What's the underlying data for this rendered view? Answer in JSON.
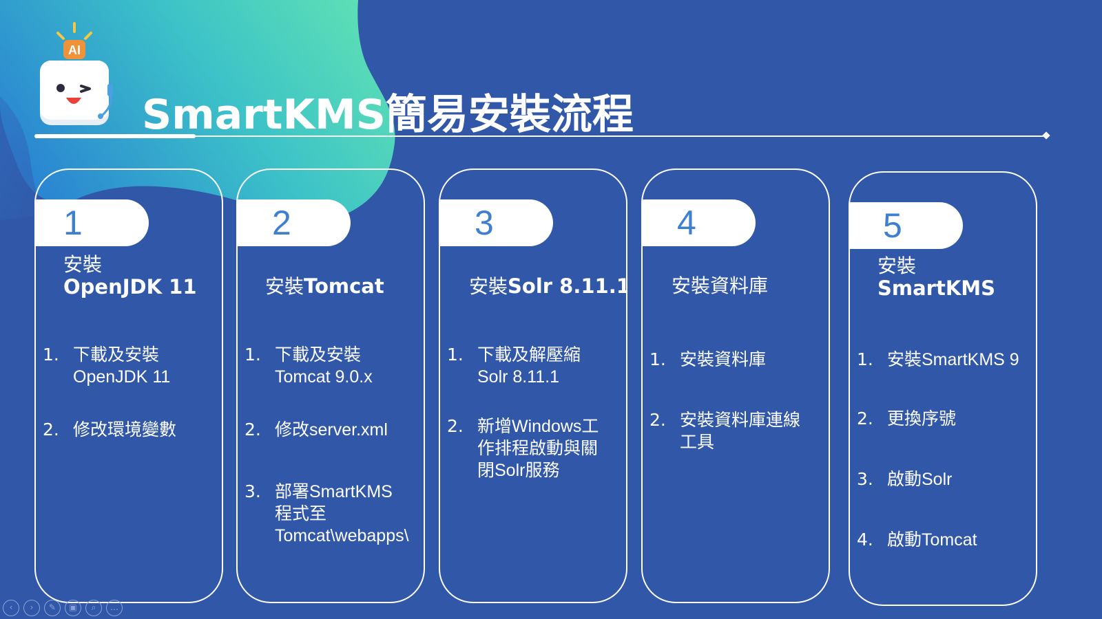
{
  "slide": {
    "title": "SmartKMS簡易安裝流程",
    "mascot_badge": "AI",
    "colors": {
      "background": "#3158a8",
      "accent_gradient_start": "#2aa2d6",
      "accent_gradient_end": "#59dcb6",
      "tab_number": "#3f7fd0",
      "text": "#ffffff"
    }
  },
  "cards": [
    {
      "number": "1",
      "title_line1": "安裝",
      "title_line2": "OpenJDK 11",
      "steps": [
        {
          "num": "1.",
          "text": "下載及安裝\nOpenJDK 11"
        },
        {
          "num": "2.",
          "text": "修改環境變數"
        }
      ]
    },
    {
      "number": "2",
      "title_line1": "安裝",
      "title_line2": "Tomcat",
      "steps": [
        {
          "num": "1.",
          "text": "下載及安裝\nTomcat 9.0.x"
        },
        {
          "num": "2.",
          "text": "修改server.xml"
        },
        {
          "num": "3.",
          "text": "部署SmartKMS\n程式至\nTomcat\\webapps\\"
        }
      ]
    },
    {
      "number": "3",
      "title_line1": "安裝",
      "title_line2": "Solr 8.11.1",
      "steps": [
        {
          "num": "1.",
          "text": "下載及解壓縮\nSolr 8.11.1"
        },
        {
          "num": "2.",
          "text": "新增Windows工\n作排程啟動與關\n閉Solr服務"
        }
      ]
    },
    {
      "number": "4",
      "title_line1": "安裝資料庫",
      "title_line2": "",
      "steps": [
        {
          "num": "1.",
          "text": "安裝資料庫"
        },
        {
          "num": "2.",
          "text": "安裝資料庫連線\n工具"
        }
      ]
    },
    {
      "number": "5",
      "title_line1": "安裝",
      "title_line2": "SmartKMS",
      "steps": [
        {
          "num": "1.",
          "text": "安裝SmartKMS 9"
        },
        {
          "num": "2.",
          "text": "更換序號"
        },
        {
          "num": "3.",
          "text": "啟動Solr"
        },
        {
          "num": "4.",
          "text": "啟動Tomcat"
        }
      ]
    }
  ],
  "nav": {
    "buttons": [
      "prev-icon",
      "next-icon",
      "pen-icon",
      "slides-icon",
      "zoom-icon",
      "more-icon"
    ],
    "glyphs": [
      "‹",
      "›",
      "✎",
      "▣",
      "⌕",
      "…"
    ]
  }
}
